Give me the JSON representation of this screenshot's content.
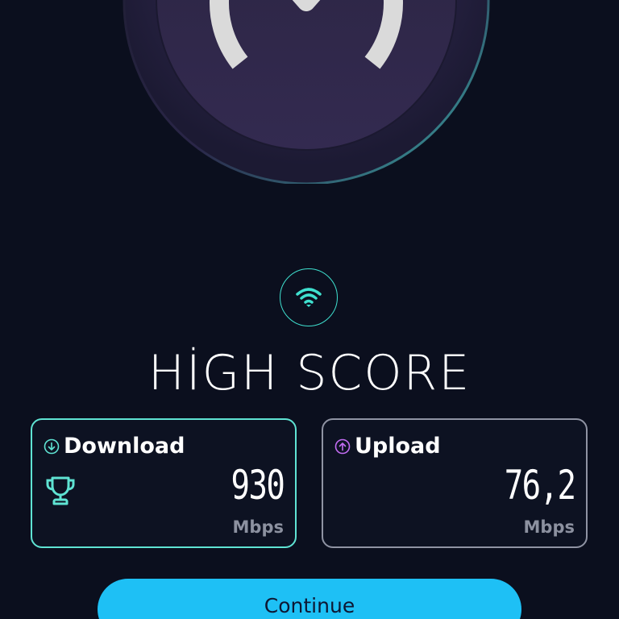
{
  "title": "HİGH SCORE",
  "download": {
    "label": "Download",
    "value": "930",
    "unit": "Mbps",
    "icon": "arrow-down-circle-icon",
    "accent": "#5fe3d3"
  },
  "upload": {
    "label": "Upload",
    "value": "76,2",
    "unit": "Mbps",
    "icon": "arrow-up-circle-icon",
    "accent": "#c26cf2"
  },
  "continue_label": "Continue",
  "colors": {
    "background": "#0b0f1e",
    "teal": "#3fe0cf",
    "button": "#1ec0f5"
  }
}
